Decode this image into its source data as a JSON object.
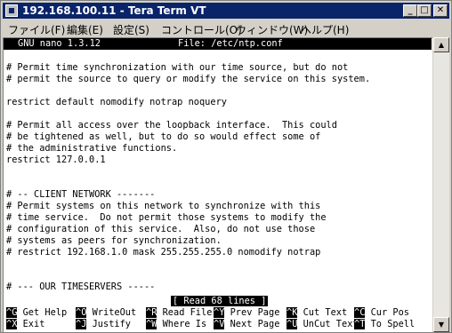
{
  "window": {
    "title": "192.168.100.11 - Tera Term VT",
    "controls": {
      "minimize": "_",
      "maximize": "□",
      "close": "✕"
    }
  },
  "menubar": {
    "items": [
      "ファイル(F)",
      "編集(E)",
      "設定(S)",
      "コントロール(O)",
      "ウィンドウ(W)",
      "ヘルプ(H)"
    ]
  },
  "nano": {
    "version": "GNU nano 1.3.12",
    "file": "File: /etc/ntp.conf",
    "status": "[ Read 68 lines ]",
    "lines": [
      "",
      "# Permit time synchronization with our time source, but do not",
      "# permit the source to query or modify the service on this system.",
      "",
      "restrict default nomodify notrap noquery",
      "",
      "# Permit all access over the loopback interface.  This could",
      "# be tightened as well, but to do so would effect some of",
      "# the administrative functions.",
      "restrict 127.0.0.1",
      "",
      "",
      "# -- CLIENT NETWORK -------",
      "# Permit systems on this network to synchronize with this",
      "# time service.  Do not permit those systems to modify the",
      "# configuration of this service.  Also, do not use those",
      "# systems as peers for synchronization.",
      "# restrict 192.168.1.0 mask 255.255.255.0 nomodify notrap",
      "",
      "",
      "# --- OUR TIMESERVERS -----"
    ],
    "shortcuts_row1": [
      {
        "key": "^G",
        "label": "Get Help"
      },
      {
        "key": "^O",
        "label": "WriteOut"
      },
      {
        "key": "^R",
        "label": "Read File"
      },
      {
        "key": "^Y",
        "label": "Prev Page"
      },
      {
        "key": "^K",
        "label": "Cut Text"
      },
      {
        "key": "^C",
        "label": "Cur Pos"
      }
    ],
    "shortcuts_row2": [
      {
        "key": "^X",
        "label": "Exit"
      },
      {
        "key": "^J",
        "label": "Justify"
      },
      {
        "key": "^W",
        "label": "Where Is"
      },
      {
        "key": "^V",
        "label": "Next Page"
      },
      {
        "key": "^U",
        "label": "UnCut Text"
      },
      {
        "key": "^T",
        "label": "To Spell"
      }
    ]
  },
  "scrollbar": {
    "up": "▲",
    "down": "▼"
  }
}
